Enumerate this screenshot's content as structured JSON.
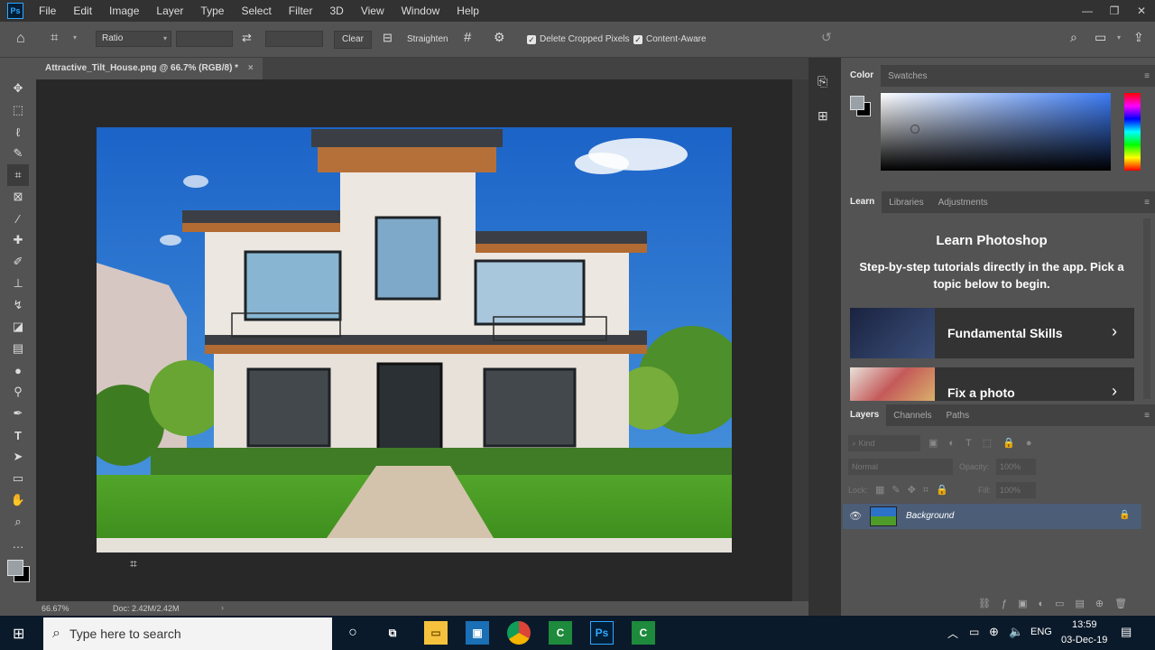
{
  "menubar": {
    "logo": "Ps",
    "items": [
      "File",
      "Edit",
      "Image",
      "Layer",
      "Type",
      "Select",
      "Filter",
      "3D",
      "View",
      "Window",
      "Help"
    ]
  },
  "options": {
    "ratio": "Ratio",
    "clear": "Clear",
    "straighten": "Straighten",
    "delete_cropped": "Delete Cropped Pixels",
    "content_aware": "Content-Aware"
  },
  "document": {
    "tab_title": "Attractive_Tilt_House.png @ 66.7% (RGB/8) *",
    "zoom": "66.67%",
    "doc_size": "Doc: 2.42M/2.42M"
  },
  "color_panel": {
    "tabs": [
      "Color",
      "Swatches"
    ]
  },
  "learn_panel": {
    "tabs": [
      "Learn",
      "Libraries",
      "Adjustments"
    ],
    "title": "Learn Photoshop",
    "subtitle": "Step-by-step tutorials directly in the app. Pick a topic below to begin.",
    "cards": [
      "Fundamental Skills",
      "Fix a photo"
    ]
  },
  "layers_panel": {
    "tabs": [
      "Layers",
      "Channels",
      "Paths"
    ],
    "kind": "Kind",
    "blend": "Normal",
    "opacity_label": "Opacity:",
    "opacity_val": "100%",
    "lock_label": "Lock:",
    "fill_label": "Fill:",
    "fill_val": "100%",
    "layer_name": "Background"
  },
  "taskbar": {
    "search": "Type here to search",
    "lang": "ENG",
    "time": "13:59",
    "date": "03-Dec-19"
  },
  "colors": {
    "accent": "#31a8ff",
    "layer_selected": "#4b5d77"
  }
}
